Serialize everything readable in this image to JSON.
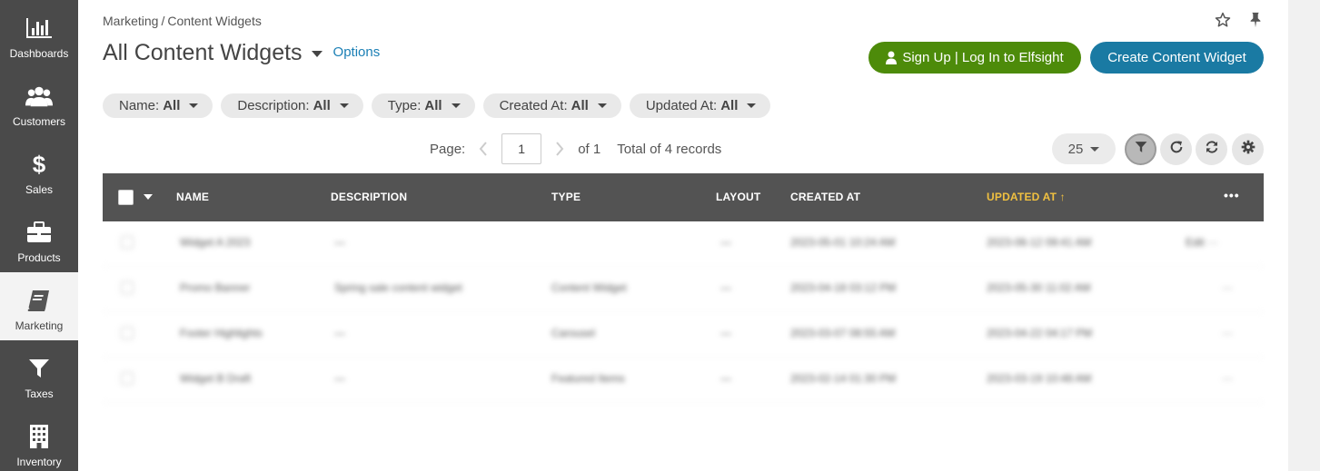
{
  "sidebar": {
    "items": [
      {
        "label": "Dashboards",
        "icon": "bar-chart-icon"
      },
      {
        "label": "Customers",
        "icon": "users-icon"
      },
      {
        "label": "Sales",
        "icon": "dollar-icon"
      },
      {
        "label": "Products",
        "icon": "briefcase-icon"
      },
      {
        "label": "Marketing",
        "icon": "book-icon",
        "active": true
      },
      {
        "label": "Taxes",
        "icon": "filter-icon"
      },
      {
        "label": "Inventory",
        "icon": "building-icon"
      }
    ]
  },
  "breadcrumb": {
    "parent": "Marketing",
    "separator": "/",
    "current": "Content Widgets"
  },
  "header": {
    "title": "All Content Widgets",
    "options_label": "Options",
    "signup_label": "Sign Up | Log In to Elfsight",
    "create_label": "Create Content Widget"
  },
  "filters": [
    {
      "name": "Name:",
      "value": "All"
    },
    {
      "name": "Description:",
      "value": "All"
    },
    {
      "name": "Type:",
      "value": "All"
    },
    {
      "name": "Created At:",
      "value": "All"
    },
    {
      "name": "Updated At:",
      "value": "All"
    }
  ],
  "pagination": {
    "page_label": "Page:",
    "current_page": "1",
    "of_label": "of 1",
    "total_label": "Total of 4 records",
    "per_page": "25"
  },
  "table": {
    "columns": [
      "NAME",
      "DESCRIPTION",
      "TYPE",
      "LAYOUT",
      "CREATED AT",
      "UPDATED AT ↑"
    ],
    "sorted_column": "UPDATED AT",
    "rows": [
      {
        "name": "Widget A 2023",
        "description": "—",
        "type": "",
        "layout": "—",
        "created": "2023-05-01 10:24 AM",
        "updated": "2023-06-12 09:41 AM",
        "extra": "Edit ···"
      },
      {
        "name": "Promo Banner",
        "description": "Spring sale content widget",
        "type": "Content Widget",
        "layout": "—",
        "created": "2023-04-18 03:12 PM",
        "updated": "2023-05-30 11:02 AM",
        "extra": "···"
      },
      {
        "name": "Footer Highlights",
        "description": "—",
        "type": "Carousel",
        "layout": "—",
        "created": "2023-03-07 08:55 AM",
        "updated": "2023-04-22 04:17 PM",
        "extra": "···"
      },
      {
        "name": "Widget B Draft",
        "description": "—",
        "type": "Featured Items",
        "layout": "—",
        "created": "2023-02-14 01:30 PM",
        "updated": "2023-03-19 10:48 AM",
        "extra": "···"
      }
    ]
  },
  "colors": {
    "sidebar_bg": "#4a4a4a",
    "signup_btn": "#4d8b0a",
    "create_btn": "#1a7aa3",
    "table_header": "#535353",
    "sorted_header": "#f0c040",
    "link": "#1a7fb5"
  }
}
